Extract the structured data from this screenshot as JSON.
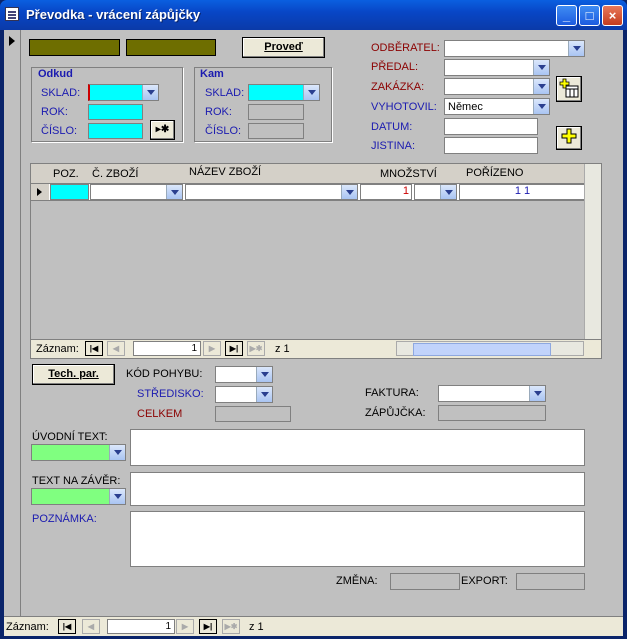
{
  "window": {
    "title": "Převodka - vrácení zápůjčky"
  },
  "form": {
    "provest_label": "Proveď",
    "odkud": {
      "title": "Odkud",
      "sklad": "SKLAD:",
      "rok": "ROK:",
      "cislo": "ČÍSLO:"
    },
    "kam": {
      "title": "Kam",
      "sklad": "SKLAD:",
      "rok": "ROK:",
      "cislo": "ČÍSLO:"
    },
    "right": {
      "odberatel": "ODBĚRATEL:",
      "predal": "PŘEDAL:",
      "zakazka": "ZAKÁZKA:",
      "vyhotovil": "VYHOTOVIL:",
      "vyhotovil_value": "Němec",
      "datum": "DATUM:",
      "jistina": "JISTINA:"
    }
  },
  "grid": {
    "columns": [
      "POZ.",
      "Č. ZBOŽÍ",
      "NÁZEV ZBOŽÍ",
      "MNOŽSTVÍ",
      "POŘÍZENO"
    ],
    "row": {
      "mnozstvi": "1",
      "porizeno": "1 1"
    },
    "nav": {
      "label": "Záznam:",
      "record": "1",
      "of": "z 1"
    }
  },
  "lower": {
    "tech_par": "Tech. par.",
    "kod_pohybu": "KÓD POHYBU:",
    "stredisko": "STŘEDISKO:",
    "celkem": "CELKEM",
    "faktura": "FAKTURA:",
    "zapujcka": "ZÁPŮJČKA:",
    "uvodni_text": "ÚVODNÍ TEXT:",
    "text_na_zaver": "TEXT NA ZÁVĚR:",
    "poznamka": "POZNÁMKA:",
    "zmena": "ZMĚNA:",
    "export": "EXPORT:"
  },
  "footer_nav": {
    "label": "Záznam:",
    "record": "1",
    "of": "z 1"
  },
  "colors": {
    "accent_cyan": "#00ffff",
    "accent_green": "#80ff80",
    "olive": "#6e6e00",
    "label_red": "#8b0000",
    "label_blue": "#1b1bb0"
  }
}
